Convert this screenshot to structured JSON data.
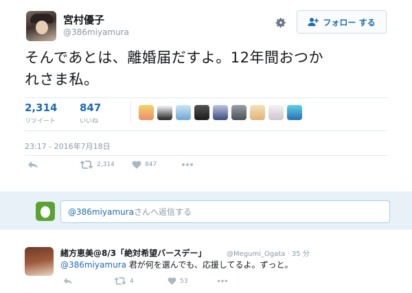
{
  "author": {
    "display_name": "宮村優子",
    "screen_name": "@386miyamura"
  },
  "follow_button": {
    "label": "フォロー する"
  },
  "tweet": {
    "line1": "そんであとは、離婚届だすよ。12年間おつか",
    "line2": "れさま私。",
    "timestamp": "23:17 - 2016年7月18日"
  },
  "stats": {
    "retweets": {
      "count": "2,314",
      "label": "リツイート"
    },
    "likes": {
      "count": "847",
      "label": "いいね"
    }
  },
  "actions": {
    "retweet_count": "2,314",
    "like_count": "847"
  },
  "reply_box": {
    "mention": "@386miyamura",
    "placeholder_rest": "さんへ返信する"
  },
  "reply": {
    "display_name": "緒方恵美@8/3「絶対希望バースデー」",
    "handle": "@Megumi_Ogata · 35 分",
    "mention": "@386miyamura",
    "text": " 君が何を選んでも、応援してるよ。ずっと。",
    "retweet_count": "4",
    "like_count": "53"
  },
  "colors": {
    "accent": "#1b6bb5",
    "muted": "#8899a6",
    "reply_bar": "#e8f1f7",
    "reply_avatar": "#5aa232"
  },
  "icons": [
    "gear-icon",
    "follow-person-icon",
    "reply-icon",
    "retweet-icon",
    "heart-icon",
    "more-icon",
    "egg-icon"
  ]
}
